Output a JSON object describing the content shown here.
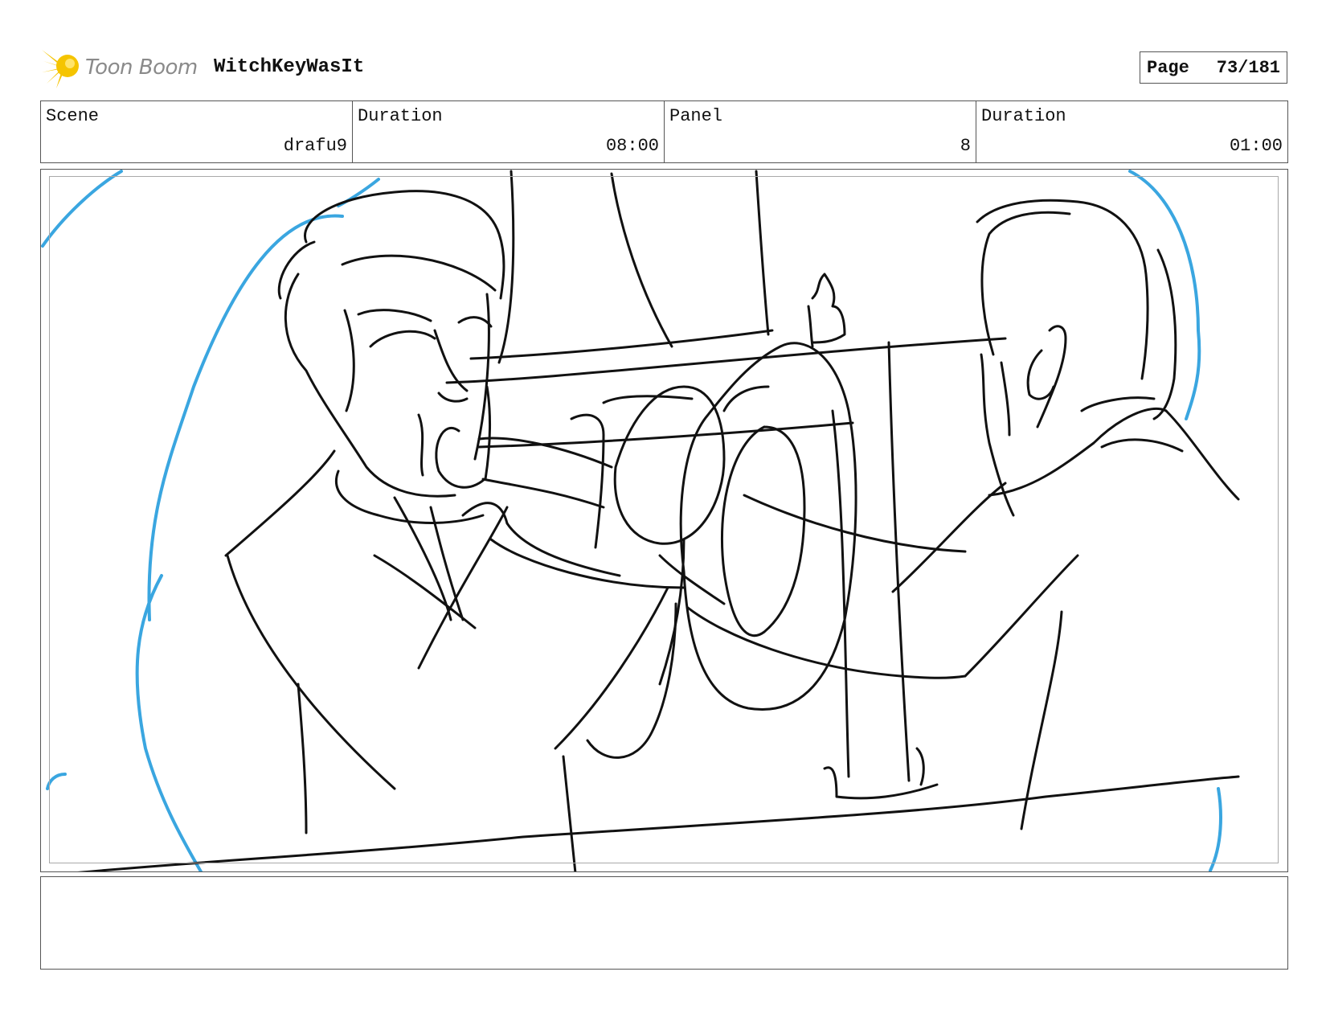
{
  "header": {
    "logo_text": "Toon Boom",
    "project_title": "WitchKeyWasIt",
    "page_label": "Page",
    "page_number": "73/181"
  },
  "info": {
    "scene_label": "Scene",
    "scene_value": "drafu9",
    "scene_duration_label": "Duration",
    "scene_duration_value": "08:00",
    "panel_label": "Panel",
    "panel_value": "8",
    "panel_duration_label": "Duration",
    "panel_duration_value": "01:00"
  },
  "notes": {
    "text": ""
  },
  "colors": {
    "sketch_line": "#111111",
    "guide_line": "#3aa6e0",
    "logo_yellow": "#f5c400",
    "logo_text": "#8a8a8a"
  },
  "icons": {
    "logo": "toon-boom-star-icon"
  }
}
